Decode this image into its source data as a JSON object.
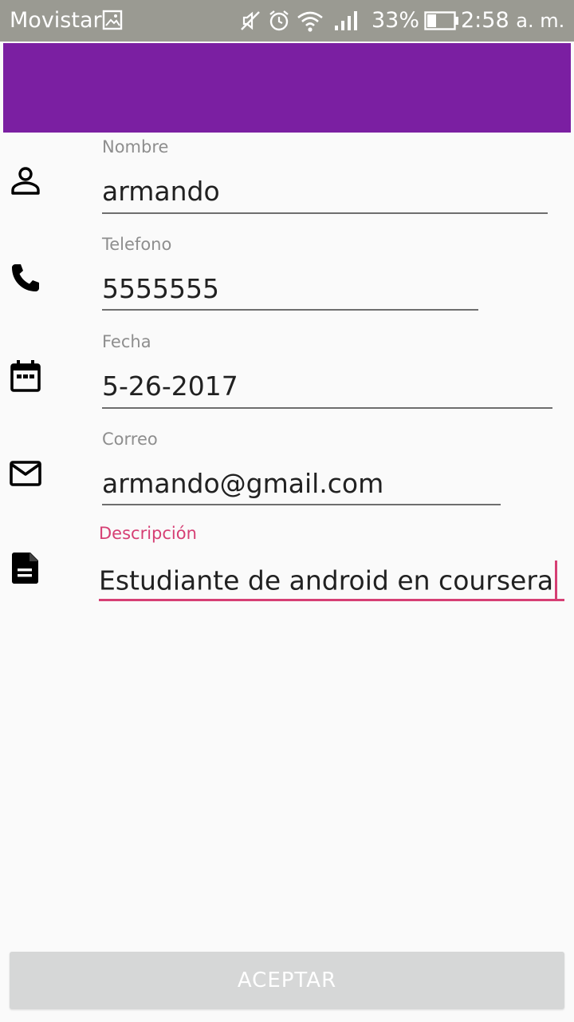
{
  "status_bar": {
    "carrier": "Movistar",
    "battery_percent": "33%",
    "time": "2:58",
    "ampm": "a. m."
  },
  "colors": {
    "app_bar": "#7b1fa2",
    "accent": "#d63f74",
    "button_disabled": "#d6d7d7"
  },
  "form": {
    "fields": [
      {
        "label": "Nombre",
        "value": "armando",
        "icon": "person-icon"
      },
      {
        "label": "Telefono",
        "value": "5555555",
        "icon": "phone-icon"
      },
      {
        "label": "Fecha",
        "value": "5-26-2017",
        "icon": "calendar-icon"
      },
      {
        "label": "Correo",
        "value": "armando@gmail.com",
        "icon": "mail-icon"
      },
      {
        "label": "Descripción",
        "value": "Estudiante de android en coursera",
        "icon": "description-icon",
        "focused": true
      }
    ]
  },
  "button": {
    "label": "ACEPTAR",
    "enabled": false
  }
}
